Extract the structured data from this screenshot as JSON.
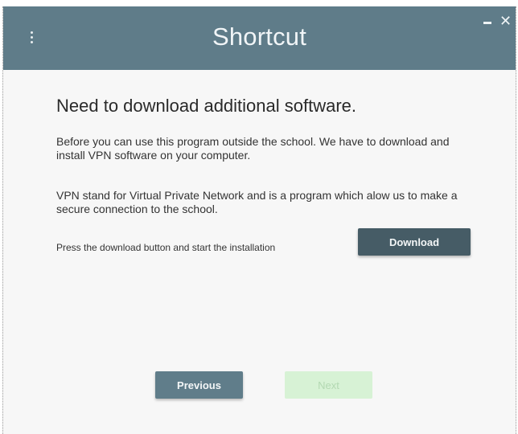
{
  "window": {
    "title": "Shortcut",
    "menu_icon": "more-vertical-icon",
    "minimize_icon": "minimize-icon",
    "close_icon": "close-icon",
    "close_glyph": "✕"
  },
  "content": {
    "heading": "Need to download additional software.",
    "paragraph1": "Before you can use this program outside the school. We have to download and install VPN software on your computer.",
    "paragraph2": "VPN stand for Virtual Private Network and is a program which alow us to make a secure connection to the school.",
    "instruction": "Press the download button and start the installation",
    "download_label": "Download"
  },
  "footer": {
    "previous_label": "Previous",
    "next_label": "Next",
    "next_enabled": false
  },
  "colors": {
    "titlebar": "#5f7c89",
    "primary_button": "#465c66",
    "secondary_button": "#607d8a",
    "disabled_button": "#d7f2d5",
    "background": "#f7f7f7"
  }
}
